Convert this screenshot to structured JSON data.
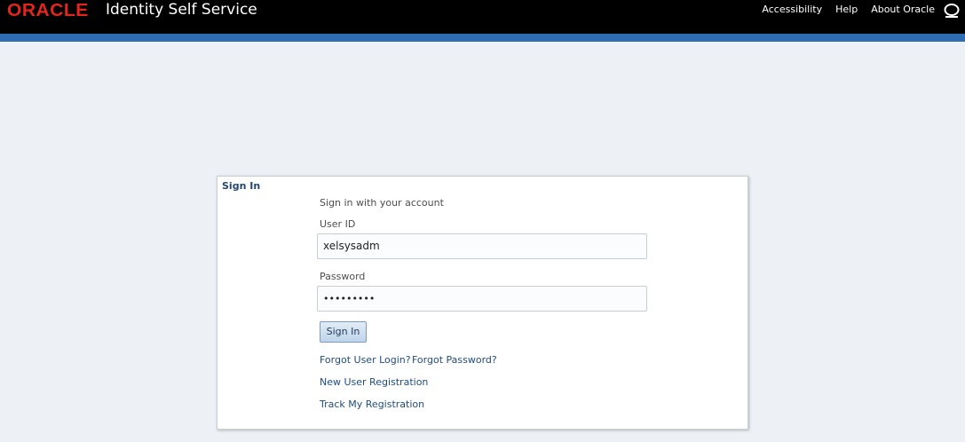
{
  "header": {
    "logo_text": "ORACLE",
    "app_title": "Identity Self Service",
    "links": [
      "Accessibility",
      "Help",
      "About Oracle"
    ],
    "brand_color": "#e2261d",
    "strip_color": "#2e6db2"
  },
  "signin": {
    "title": "Sign In",
    "caption": "Sign in with your account",
    "userid_label": "User ID",
    "userid_value": "xelsysadm",
    "password_label": "Password",
    "password_value": "•••••••••",
    "button_label": "Sign In",
    "links": {
      "forgot_login": "Forgot User Login?",
      "forgot_password": "Forgot Password?",
      "new_user": "New User Registration",
      "track": "Track My Registration"
    }
  }
}
